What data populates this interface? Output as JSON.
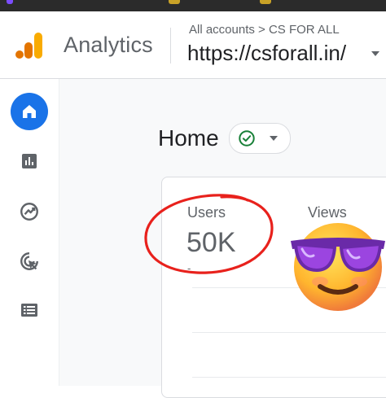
{
  "header": {
    "app_name": "Analytics",
    "breadcrumb": "All accounts > CS FOR ALL",
    "property_url": "https://csforall.in/"
  },
  "colors": {
    "accent": "#1a73e8",
    "logo_orange": "#f9ab00",
    "logo_dark_orange": "#e37400",
    "success": "#188038",
    "annotation_red": "#e8211c"
  },
  "rail": {
    "items": [
      {
        "icon": "home-icon",
        "active": true
      },
      {
        "icon": "reports-icon",
        "active": false
      },
      {
        "icon": "explore-icon",
        "active": false
      },
      {
        "icon": "advertising-icon",
        "active": false
      },
      {
        "icon": "list-icon",
        "active": false
      }
    ]
  },
  "main": {
    "page_title": "Home",
    "status_icon": "check-circle-icon"
  },
  "card": {
    "metrics": [
      {
        "label": "Users",
        "value": "50K",
        "change": "-"
      },
      {
        "label": "Views",
        "value": "",
        "change": ""
      }
    ]
  },
  "overlay": {
    "emoji": "sunglasses-emoji"
  }
}
